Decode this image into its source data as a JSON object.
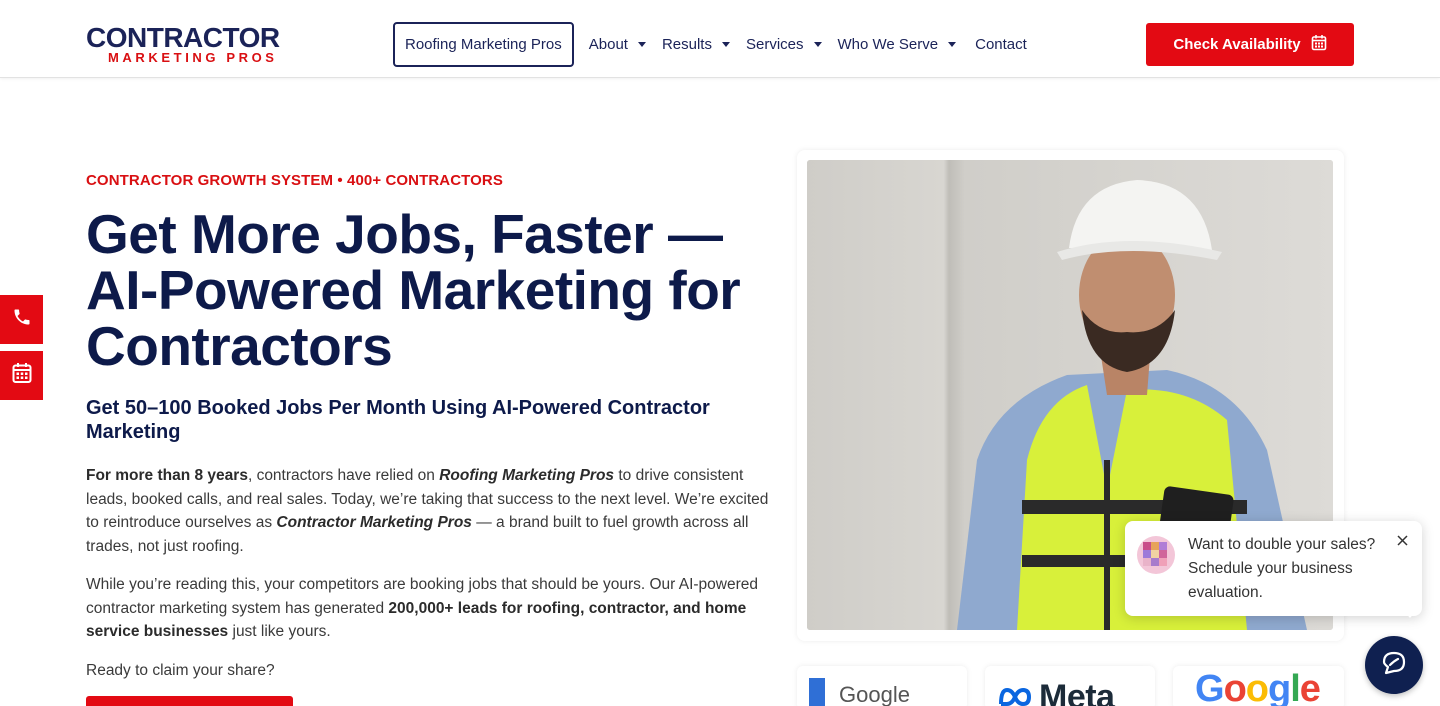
{
  "header": {
    "logo": {
      "top": "CONTRACTOR",
      "bottom": "MARKETING PROS"
    },
    "nav": {
      "active": "Roofing Marketing Pros",
      "items": [
        {
          "label": "About",
          "has_dropdown": true
        },
        {
          "label": "Results",
          "has_dropdown": true
        },
        {
          "label": "Services",
          "has_dropdown": true
        },
        {
          "label": "Who We Serve",
          "has_dropdown": true
        },
        {
          "label": "Contact",
          "has_dropdown": false
        }
      ]
    },
    "cta_label": "Check Availability",
    "cta_icon": "calendar-icon"
  },
  "side_buttons": [
    {
      "icon": "phone-icon"
    },
    {
      "icon": "calendar-icon"
    }
  ],
  "hero": {
    "eyebrow": "CONTRACTOR GROWTH SYSTEM • 400+ CONTRACTORS",
    "headline": "Get More Jobs, Faster — AI-Powered Marketing for Contractors",
    "subhead": "Get 50–100 Booked Jobs Per Month Using AI-Powered Contractor Marketing",
    "p1": {
      "bold1": "For more than 8 years",
      "t1": ", contractors have relied on ",
      "em1": "Roofing Marketing Pros",
      "t2": " to drive consistent leads, booked calls, and real sales. Today, we’re taking that success to the next level. We’re excited to reintroduce ourselves as ",
      "em2": "Contractor Marketing Pros",
      "t3": " — a brand built to fuel growth across all trades, not just roofing."
    },
    "p2": {
      "t1": "While you’re reading this, your competitors are booking jobs that should be yours. Our AI-powered contractor marketing system has generated ",
      "bold1": "200,000+ leads for roofing, contractor, and home service businesses",
      "t2": " just like yours."
    },
    "p3": "Ready to claim your share?"
  },
  "partner_logos": [
    {
      "label": "Google"
    },
    {
      "label": "Meta"
    },
    {
      "label": "Google"
    }
  ],
  "chat": {
    "message": "Want to double your sales? Schedule your business evaluation.",
    "close_icon": "close-icon",
    "fab_icon": "chat-bubble-icon"
  },
  "colors": {
    "brand_red": "#e30a13",
    "brand_navy": "#0d1a4a",
    "chat_fab": "#0f2050"
  }
}
